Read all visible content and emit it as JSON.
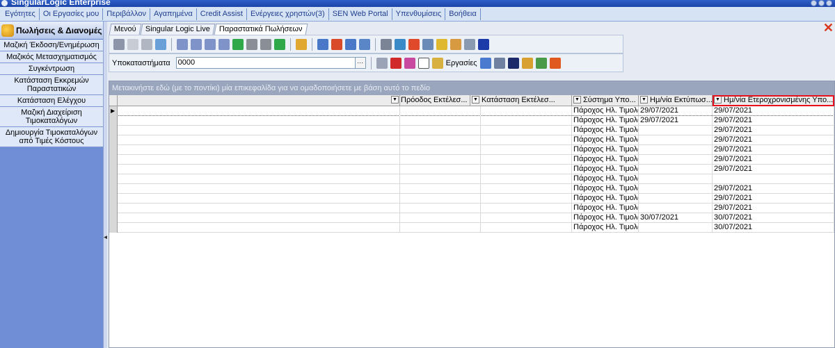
{
  "window": {
    "title": "SingularLogic Enterprise"
  },
  "menu": [
    "Εγότητες",
    "Οι Εργασίες μου",
    "Περιβάλλον",
    "Αγαπημένα",
    "Credit Assist",
    "Ενέργειες χρηστών(3)",
    "SEN Web Portal",
    "Υπενθυμίσεις",
    "Βοήθεια"
  ],
  "sidebar": {
    "title": "Πωλήσεις & Διανομές",
    "items": [
      "Μαζική Έκδοση/Ενημέρωση",
      "Μαζικός Μετασχηματισμός",
      "Συγκέντρωση",
      "Κατάσταση Εκκρεμών Παραστατικών",
      "Κατάσταση Ελέγχου",
      "Μαζική Διαχείριση Τιμοκαταλόγων",
      "Δημιουργία Τιμοκαταλόγων από Τιμές Κόστους"
    ]
  },
  "tabs": [
    "Μενού",
    "Singular Logic Live",
    "Παραστατικά Πωλήσεων"
  ],
  "toolbar2": {
    "branch_label": "Υποκαταστήματα",
    "branch_value": "0000",
    "tasks_label": "Εργασίες"
  },
  "grid": {
    "group_hint": "Μετακινήστε εδώ (με το ποντίκι) μία επικεφαλίδα για να ομαδοποιήσετε με βάση αυτό το πεδίο",
    "columns": [
      "Πρόοδος Εκτέλεσ...",
      "Κατάσταση Εκτέλεσ...",
      "Σύστημα Υπο...",
      "Ημ/νία Εκτύπωσ...",
      "Ημ/νία Ετεροχρονισμένης Υπο..."
    ],
    "rows": [
      [
        "",
        "",
        "Πάροχος Ηλ. Τιμολό",
        "29/07/2021",
        "29/07/2021"
      ],
      [
        "",
        "",
        "Πάροχος Ηλ. Τιμολό",
        "29/07/2021",
        "29/07/2021"
      ],
      [
        "",
        "",
        "Πάροχος Ηλ. Τιμολό",
        "",
        "29/07/2021"
      ],
      [
        "",
        "",
        "Πάροχος Ηλ. Τιμολό",
        "",
        "29/07/2021"
      ],
      [
        "",
        "",
        "Πάροχος Ηλ. Τιμολό",
        "",
        "29/07/2021"
      ],
      [
        "",
        "",
        "Πάροχος Ηλ. Τιμολό",
        "",
        "29/07/2021"
      ],
      [
        "",
        "",
        "Πάροχος Ηλ. Τιμολό",
        "",
        "29/07/2021"
      ],
      [
        "",
        "",
        "Πάροχος Ηλ. Τιμολό",
        "",
        ""
      ],
      [
        "",
        "",
        "Πάροχος Ηλ. Τιμολό",
        "",
        "29/07/2021"
      ],
      [
        "",
        "",
        "Πάροχος Ηλ. Τιμολό",
        "",
        "29/07/2021"
      ],
      [
        "",
        "",
        "Πάροχος Ηλ. Τιμολό",
        "",
        "29/07/2021"
      ],
      [
        "",
        "",
        "Πάροχος Ηλ. Τιμολό",
        "30/07/2021",
        "30/07/2021"
      ],
      [
        "",
        "",
        "Πάροχος Ηλ. Τιμολό",
        "",
        "30/07/2021"
      ]
    ]
  },
  "colors": {
    "highlight": "#e8101c",
    "sidebar_bg": "#6f8ed6",
    "menu_text": "#1e3e8c"
  },
  "icons": [
    "close-icon",
    "sidebar-section-icon",
    "row-indicator-icon"
  ]
}
